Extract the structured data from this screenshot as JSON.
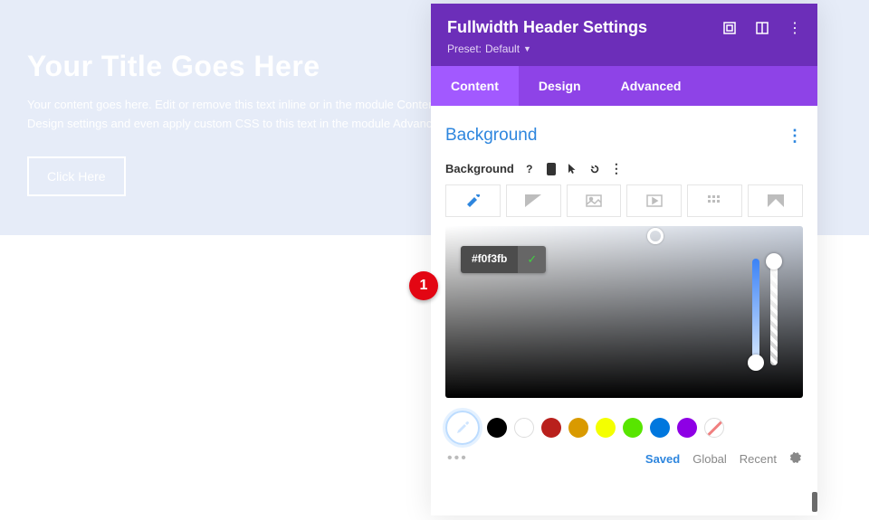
{
  "hero": {
    "title": "Your Title Goes Here",
    "body": "Your content goes here. Edit or remove this text inline or in the module Content settings. You can also style every aspect of this content in the module Design settings and even apply custom CSS to this text in the module Advanced settings.",
    "button": "Click Here"
  },
  "panel": {
    "title": "Fullwidth Header Settings",
    "preset_label": "Preset:",
    "preset_value": "Default",
    "tabs": [
      "Content",
      "Design",
      "Advanced"
    ],
    "active_tab": 0,
    "section": "Background",
    "field_label": "Background",
    "hex": "#f0f3fb",
    "swatches": [
      "#000000",
      "#ffffff",
      "#b9201c",
      "#d99a00",
      "#f4ff00",
      "#58e500",
      "#0077de",
      "#8e00e5"
    ],
    "bottom_tabs": [
      "Saved",
      "Global",
      "Recent"
    ],
    "bottom_active": 0
  },
  "annotation": {
    "badge": "1"
  }
}
